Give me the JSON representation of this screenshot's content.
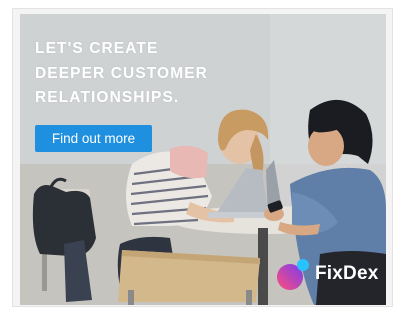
{
  "ad": {
    "headline_lines": [
      "LET'S CREATE",
      "DEEPER CUSTOMER",
      "RELATIONSHIPS."
    ],
    "cta_label": "Find out more",
    "brand_name": "FixDex",
    "colors": {
      "cta_background": "#1f8fe0",
      "text": "#ffffff",
      "logo_gradient_start": "#ff4d7a",
      "logo_gradient_end": "#7a3df0",
      "logo_dot": "#28c2ff"
    },
    "image_description_icon": "photo-two-women-laptop-phone"
  }
}
